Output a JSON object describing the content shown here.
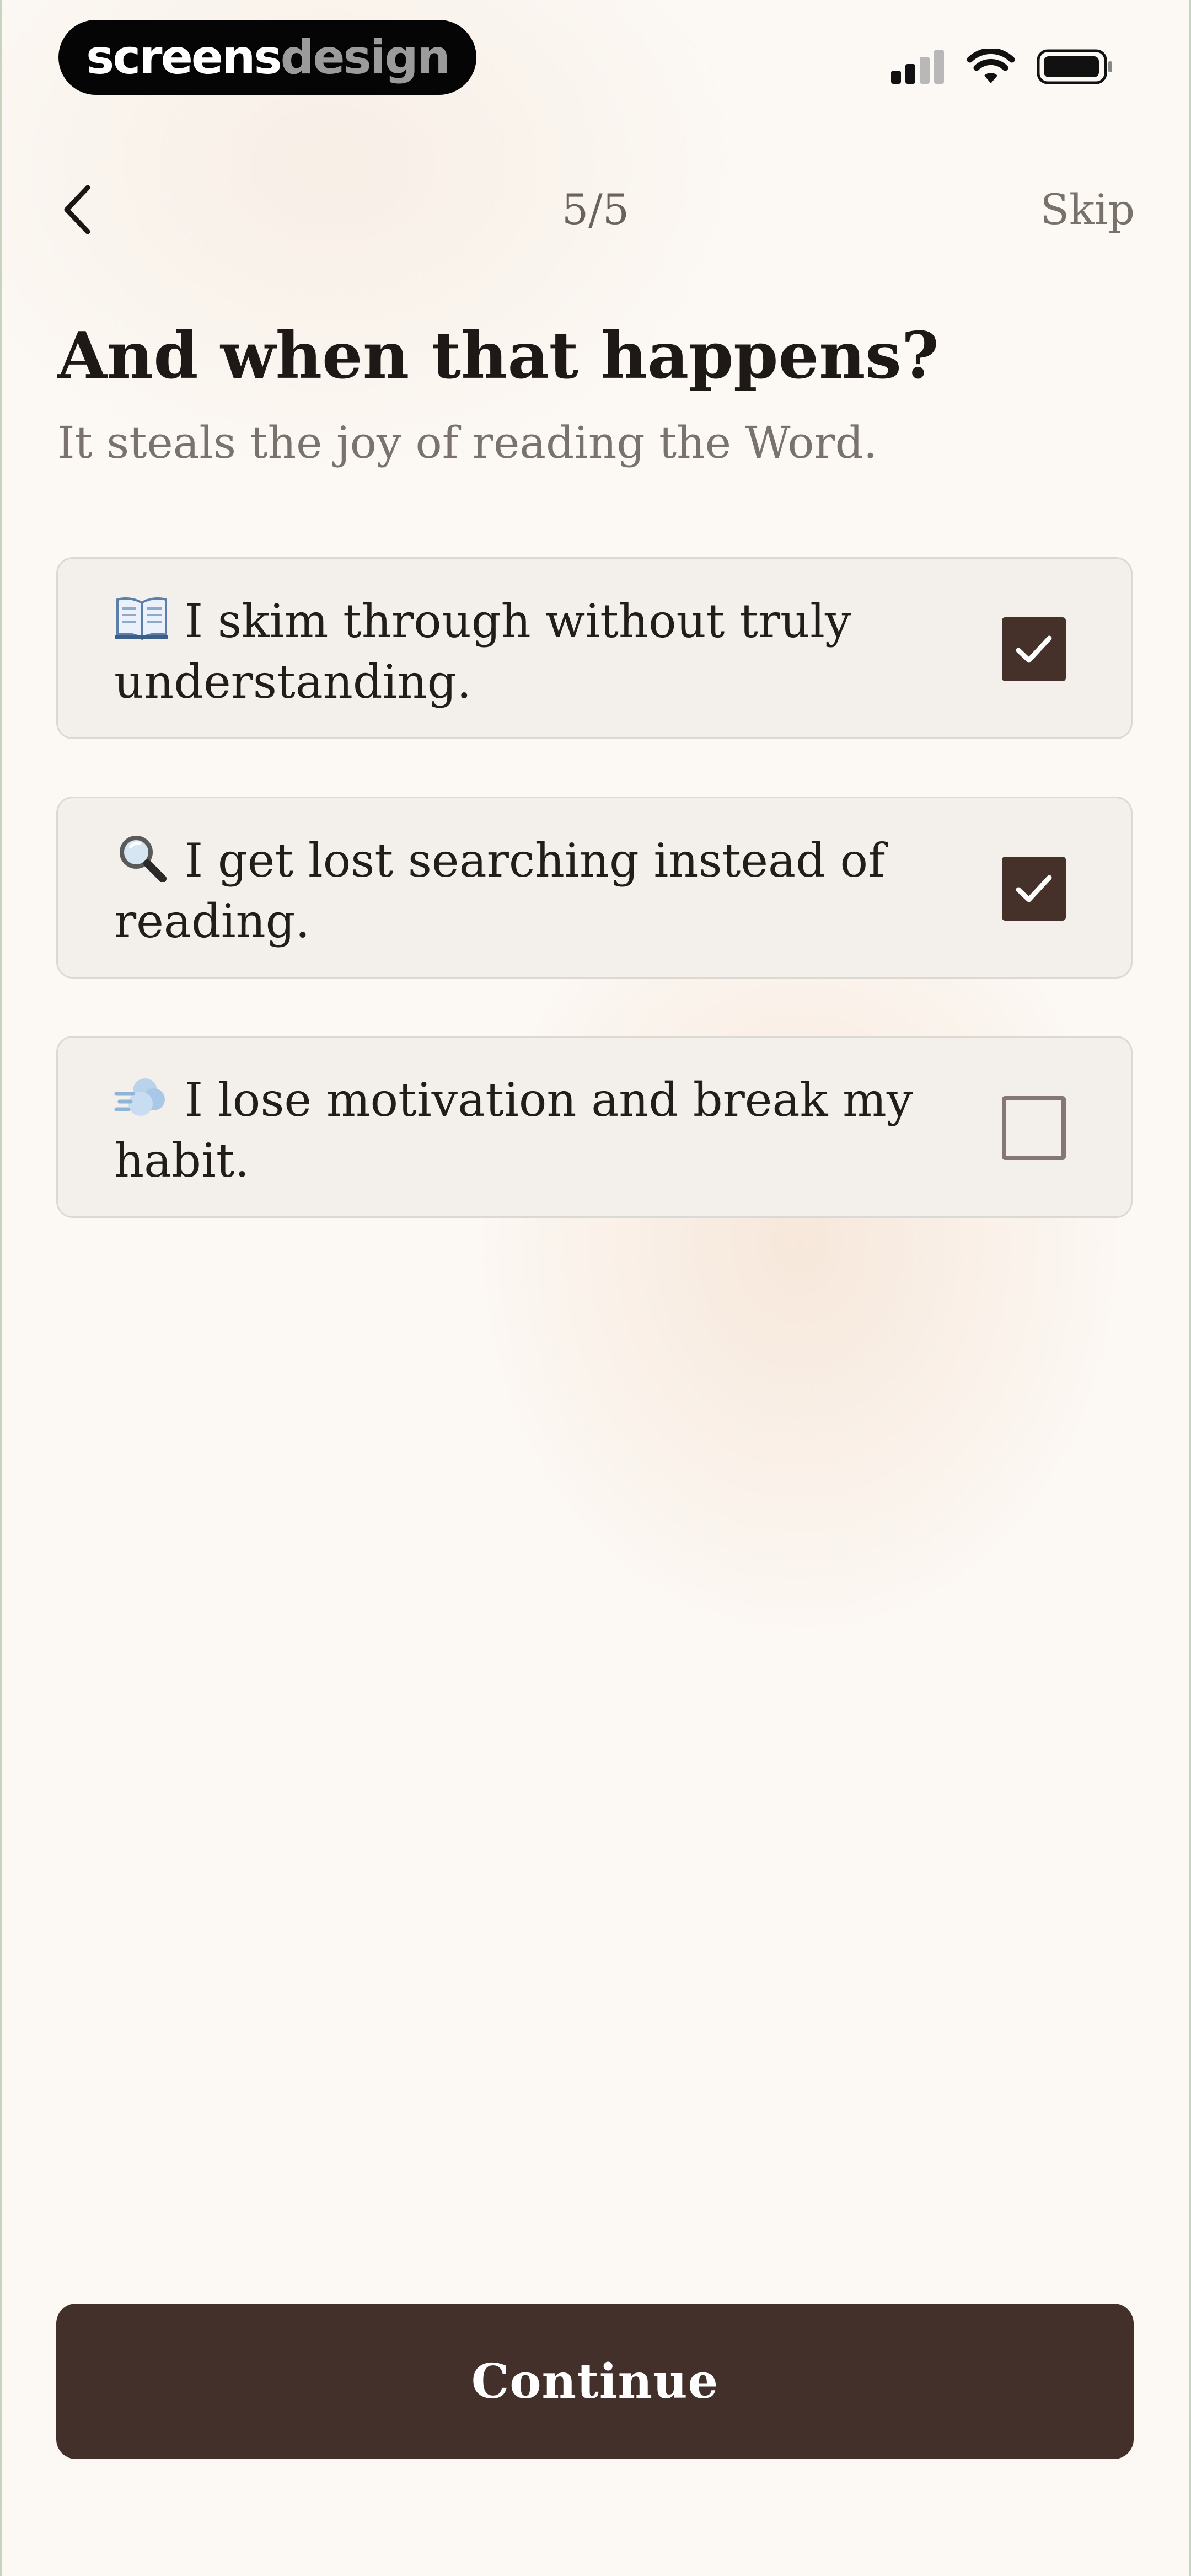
{
  "status_bar": {
    "brand_part1": "screens",
    "brand_part2": "design",
    "icons": [
      "cellular-signal-icon",
      "wifi-icon",
      "battery-icon"
    ]
  },
  "nav": {
    "back_icon": "chevron-left-icon",
    "step": "5/5",
    "skip_label": "Skip"
  },
  "header": {
    "title": "And when that happens?",
    "subtitle": "It steals the joy of reading the Word."
  },
  "options": [
    {
      "icon": "open-book-icon",
      "label": "I skim through without truly understanding.",
      "checked": true
    },
    {
      "icon": "magnifying-glass-icon",
      "label": "I get lost searching instead of reading.",
      "checked": true
    },
    {
      "icon": "dash-cloud-icon",
      "label": "I lose motivation and break my habit.",
      "checked": false
    }
  ],
  "footer": {
    "continue_label": "Continue"
  },
  "colors": {
    "background": "#fcf9f5",
    "option_bg": "#f3f0ec",
    "checkbox_checked": "#46302a",
    "button_bg": "#43302b"
  }
}
